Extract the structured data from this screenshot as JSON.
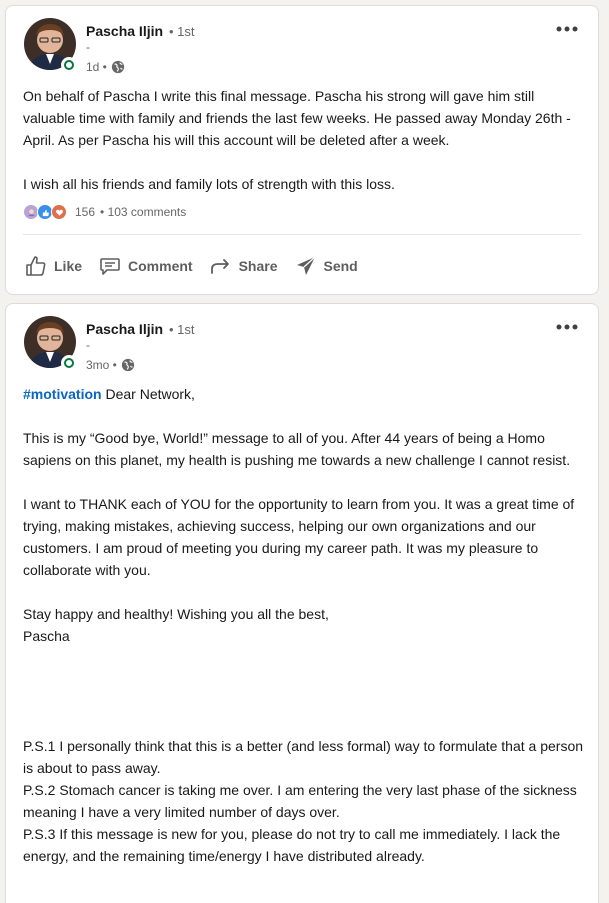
{
  "posts": [
    {
      "author": {
        "name": "Pascha Iljin",
        "degree": "• 1st",
        "subtitle": "-"
      },
      "time": "1d •",
      "body": [
        "On behalf of Pascha I write this final message. Pascha his strong will gave him still valuable time with family and friends the last few weeks. He passed away Monday 26th -April. As per Pascha his will this account will be deleted after a week.",
        "I wish all his friends and family lots of strength with this loss."
      ],
      "reactions_count": "156",
      "comments_count": "• 103 comments",
      "actions": {
        "like": "Like",
        "comment": "Comment",
        "share": "Share",
        "send": "Send"
      }
    },
    {
      "author": {
        "name": "Pascha Iljin",
        "degree": "• 1st",
        "subtitle": "-"
      },
      "time": "3mo •",
      "hashtag": "#motivation",
      "greeting": " Dear Network,",
      "paragraphs": [
        "This is my “Good bye, World!” message to all of you. After 44 years of being a Homo sapiens on this planet, my health is pushing me towards a new challenge I cannot resist.",
        "I want to THANK each of YOU for the opportunity to learn from you. It was a great time of trying, making mistakes, achieving success, helping our own organizations and our customers. I am proud of meeting you during my career path. It was my pleasure to collaborate with you.",
        "Stay happy and healthy! Wishing you all the best,",
        "Pascha"
      ],
      "ps": [
        "P.S.1 I personally think that this is a better (and less formal) way to formulate that a person is about to pass away.",
        "P.S.2 Stomach cancer is taking me over. I am entering the very last phase of the sickness meaning I have a very limited number of days over.",
        "P.S.3 If this message is new for you, please do not try to call me immediately. I lack the energy, and the remaining time/energy I have distributed already."
      ]
    }
  ],
  "icons": {
    "more": "ellipsis-icon",
    "visibility": "globe-icon",
    "presence": "online-status-icon",
    "like": "thumbs-up-icon",
    "comment": "speech-bubble-icon",
    "share": "share-arrow-icon",
    "send": "paper-plane-icon",
    "reactions": [
      "support-reaction-icon",
      "like-reaction-icon",
      "love-reaction-icon"
    ]
  },
  "colors": {
    "link": "#0a66c2",
    "online": "#057642",
    "muted": "#666666",
    "page_bg": "#f3f2ef"
  }
}
